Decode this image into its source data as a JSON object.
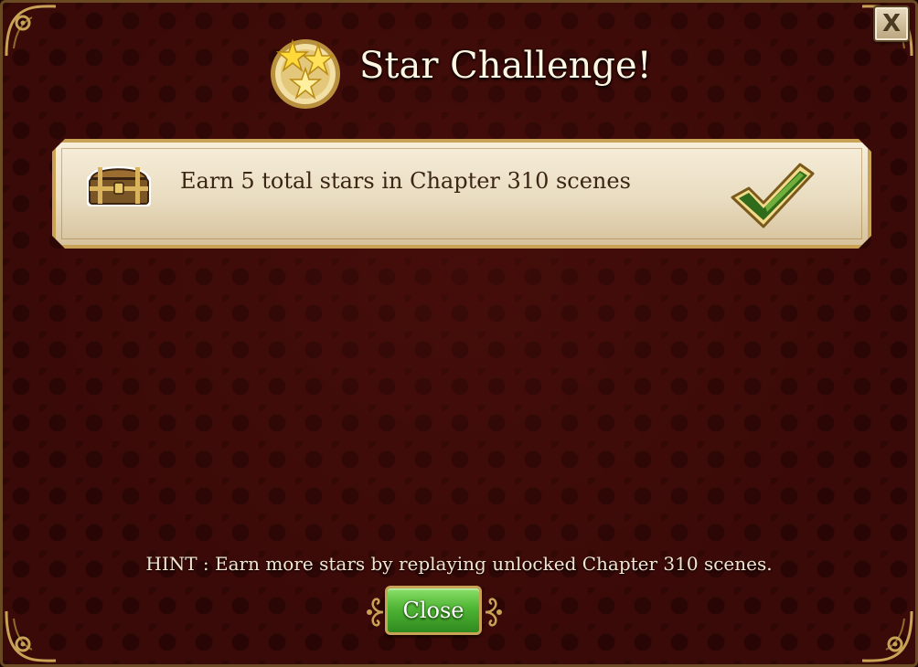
{
  "dialog": {
    "title": "Star Challenge!",
    "close_x_label": "X"
  },
  "challenge": {
    "text": "Earn 5 total stars in Chapter 310 scenes",
    "completed": true
  },
  "hint": {
    "text": "HINT : Earn more stars by replaying unlocked Chapter 310 scenes."
  },
  "footer": {
    "close_label": "Close"
  },
  "icons": {
    "title": "stars-medal-icon",
    "challenge": "treasure-chest-icon",
    "status": "checkmark-icon"
  },
  "colors": {
    "background": "#3a0a08",
    "gold_trim": "#c9a256",
    "card": "#efe3c9",
    "button_green": "#4fb534",
    "check_green": "#2f6b1a"
  }
}
